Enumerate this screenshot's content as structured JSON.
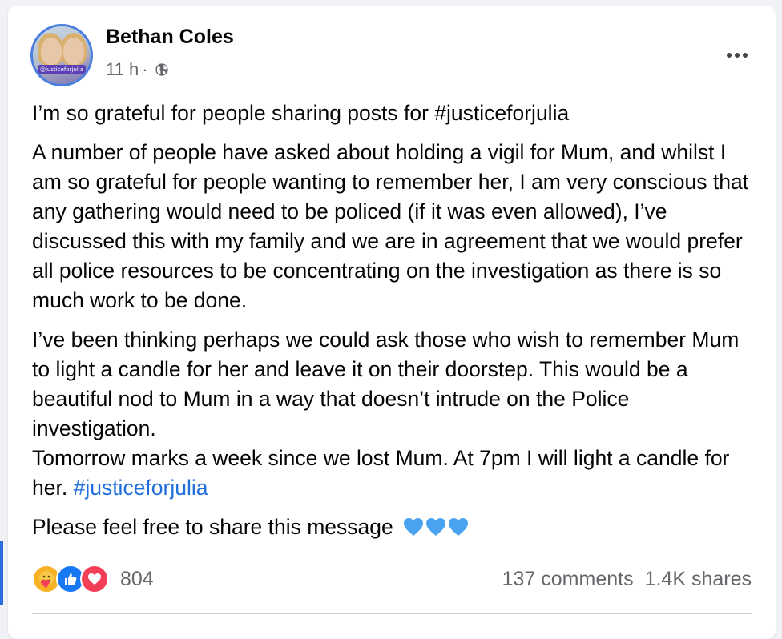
{
  "post": {
    "author": "Bethan Coles",
    "avatar_text": "@justiceforjulia",
    "time": "11 h",
    "separator": "·",
    "audience_icon": "globe-icon",
    "more_icon": "more-options-icon",
    "paragraphs": {
      "p1": "I’m so grateful for people sharing posts for #justiceforjulia",
      "p2": "A number of people have asked about holding a vigil for Mum, and whilst I am so grateful for people wanting to remember her, I am very conscious that any gathering would need to be policed (if it was even allowed), I’ve discussed this with my family and we are in agreement that we would prefer all police resources to be concentrating on the investigation as there is so much work to be done.",
      "p3": "I’ve been thinking perhaps we could ask those who wish to remember Mum to light a candle for her and leave it on their doorstep. This would be a beautiful nod to Mum in a way that doesn’t intrude on the Police investigation.",
      "p4_text": "Tomorrow marks a week since we lost Mum. At 7pm I will light a candle for her.",
      "p4_hashtag": "#justiceforjulia",
      "p5": "Please feel free to share this message"
    },
    "emoji": [
      "blue-heart-icon",
      "blue-heart-icon",
      "blue-heart-icon"
    ]
  },
  "reactions": {
    "types": [
      "care-reaction-icon",
      "like-reaction-icon",
      "love-reaction-icon"
    ],
    "count": "804"
  },
  "stats": {
    "comments": "137 comments",
    "shares": "1.4K shares"
  },
  "colors": {
    "hashtag": "#216fdb",
    "heart": "#4aa3f0",
    "like": "#1877f2",
    "love": "#f33e58",
    "care": "#f7b125",
    "secondary_text": "#65676b"
  }
}
